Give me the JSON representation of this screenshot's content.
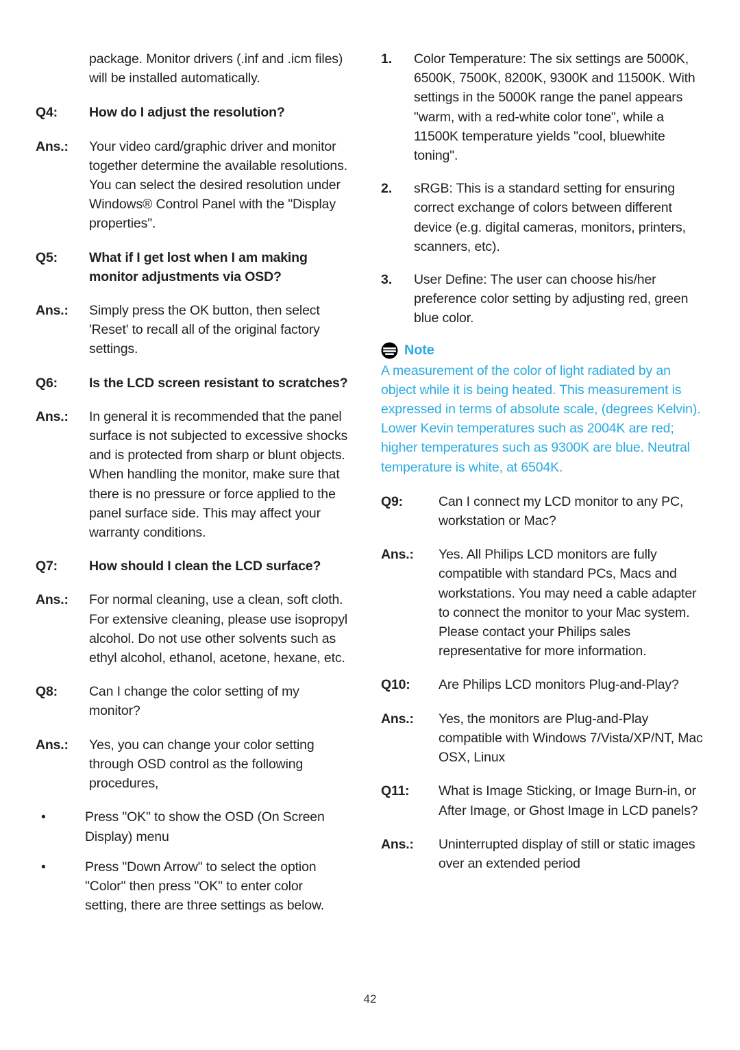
{
  "document": {
    "page_number": "42",
    "note_accent_color": "#29abe2",
    "text_color": "#231f20"
  },
  "left_column": {
    "intro_paragraph": "package. Monitor drivers (.inf and .icm files) will be installed automatically.",
    "entries": [
      {
        "label": "Q4:",
        "text": "How do I adjust the resolution?",
        "bold": true
      },
      {
        "label": "Ans.:",
        "text": "Your video card/graphic driver and monitor together determine the available resolutions. You can select the desired resolution under Windows® Control Panel with the \"Display properties\".",
        "bold": false
      },
      {
        "label": "Q5:",
        "text": "What if I get lost when I am making monitor adjustments via OSD?",
        "bold": true
      },
      {
        "label": "Ans.:",
        "text": "Simply press the OK button, then select 'Reset' to recall all of the original factory settings.",
        "bold": false
      },
      {
        "label": "Q6:",
        "text": "Is the LCD screen resistant to scratches?",
        "bold": true
      },
      {
        "label": "Ans.:",
        "text": "In general it is recommended that the panel surface is not subjected to excessive shocks and is protected from sharp or blunt objects. When handling the monitor, make sure that there is no pressure or force applied to the panel surface side. This may affect your warranty conditions.",
        "bold": false
      },
      {
        "label": "Q7:",
        "text": "How should I clean the LCD surface?",
        "bold": true
      },
      {
        "label": "Ans.:",
        "text": "For normal cleaning, use a clean, soft cloth. For extensive cleaning, please use isopropyl alcohol. Do not use other solvents such as ethyl alcohol, ethanol, acetone, hexane, etc.",
        "bold": false
      },
      {
        "label": "Q8:",
        "text": "Can I change the color setting of my monitor?",
        "bold": false
      },
      {
        "label": "Ans.:",
        "text": "Yes, you can change your color setting through OSD control as the following procedures,",
        "bold": false
      }
    ],
    "bullets": [
      {
        "marker": "•",
        "text": "Press \"OK\" to show the OSD (On Screen Display) menu"
      },
      {
        "marker": "•",
        "text": "Press \"Down Arrow\" to select the option \"Color\" then press \"OK\" to enter color setting, there are three settings as below."
      }
    ]
  },
  "right_column": {
    "numbered_items": [
      {
        "marker": "1.",
        "text": "Color Temperature: The six settings are 5000K, 6500K, 7500K, 8200K, 9300K and 11500K. With settings in the 5000K range the panel appears \"warm, with a red-white color tone\", while a 11500K temperature yields \"cool, bluewhite toning\"."
      },
      {
        "marker": "2.",
        "text": "sRGB: This is a standard setting for ensuring correct exchange of colors between different device (e.g. digital cameras, monitors, printers, scanners, etc)."
      },
      {
        "marker": "3.",
        "text": "User Define: The user can choose his/her preference color setting by adjusting red, green blue color."
      }
    ],
    "note": {
      "icon": "note-icon",
      "title": "Note",
      "body": "A measurement of the color of light radiated by an object while it is being heated. This measurement is expressed in terms of absolute scale, (degrees Kelvin). Lower Kevin temperatures such as 2004K are red; higher temperatures such as 9300K are blue. Neutral temperature is white, at 6504K."
    },
    "entries": [
      {
        "label": "Q9:",
        "text": "Can I connect my LCD monitor to any PC, workstation or Mac?",
        "bold": false
      },
      {
        "label": "Ans.:",
        "text": "Yes. All Philips LCD monitors are fully compatible with standard PCs, Macs and workstations. You may need a cable adapter to connect the monitor to your Mac system. Please contact your Philips sales representative for more information.",
        "bold": false
      },
      {
        "label": "Q10:",
        "text": "Are Philips LCD monitors Plug-and-Play?",
        "bold": false
      },
      {
        "label": "Ans.:",
        "text": "Yes, the monitors are Plug-and-Play compatible with Windows 7/Vista/XP/NT, Mac OSX, Linux",
        "bold": false
      },
      {
        "label": "Q11:",
        "text": "What is Image Sticking, or Image Burn-in, or After Image, or Ghost Image in LCD panels?",
        "bold": false
      },
      {
        "label": "Ans.:",
        "text": "Uninterrupted display of still or static images over an extended period",
        "bold": false
      }
    ]
  }
}
